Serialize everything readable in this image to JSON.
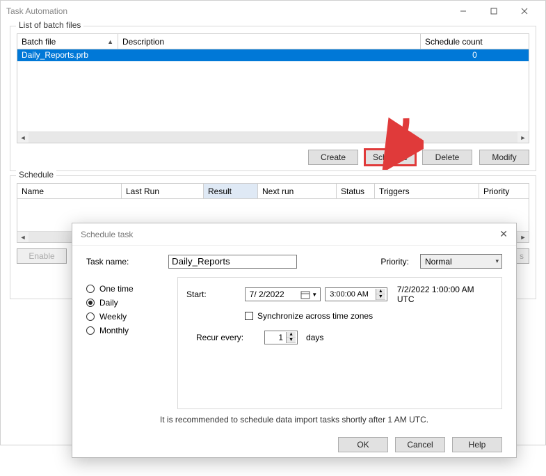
{
  "window": {
    "title": "Task Automation"
  },
  "batch": {
    "groupLabel": "List of batch files",
    "columns": {
      "file": "Batch file",
      "description": "Description",
      "count": "Schedule count"
    },
    "row": {
      "file": "Daily_Reports.prb",
      "description": "",
      "count": "0"
    },
    "buttons": {
      "create": "Create",
      "schedule": "Schedule",
      "delete": "Delete",
      "modify": "Modify"
    }
  },
  "schedule": {
    "groupLabel": "Schedule",
    "columns": {
      "name": "Name",
      "lastRun": "Last Run",
      "result": "Result",
      "nextRun": "Next run",
      "status": "Status",
      "triggers": "Triggers",
      "priority": "Priority"
    },
    "buttons": {
      "enable": "Enable",
      "stop": "s"
    }
  },
  "modal": {
    "title": "Schedule task",
    "labels": {
      "taskName": "Task name:",
      "priority": "Priority:",
      "start": "Start:",
      "sync": "Synchronize across time zones",
      "recur": "Recur every:",
      "days": "days"
    },
    "values": {
      "taskName": "Daily_Reports",
      "priority": "Normal",
      "date": "7/  2/2022",
      "time": "3:00:00 AM",
      "utc": "7/2/2022 1:00:00 AM UTC",
      "recur": "1"
    },
    "frequency": {
      "oneTime": "One time",
      "daily": "Daily",
      "weekly": "Weekly",
      "monthly": "Monthly"
    },
    "hint": "It is recommended to schedule data import tasks shortly after 1 AM UTC.",
    "buttons": {
      "ok": "OK",
      "cancel": "Cancel",
      "help": "Help"
    }
  }
}
